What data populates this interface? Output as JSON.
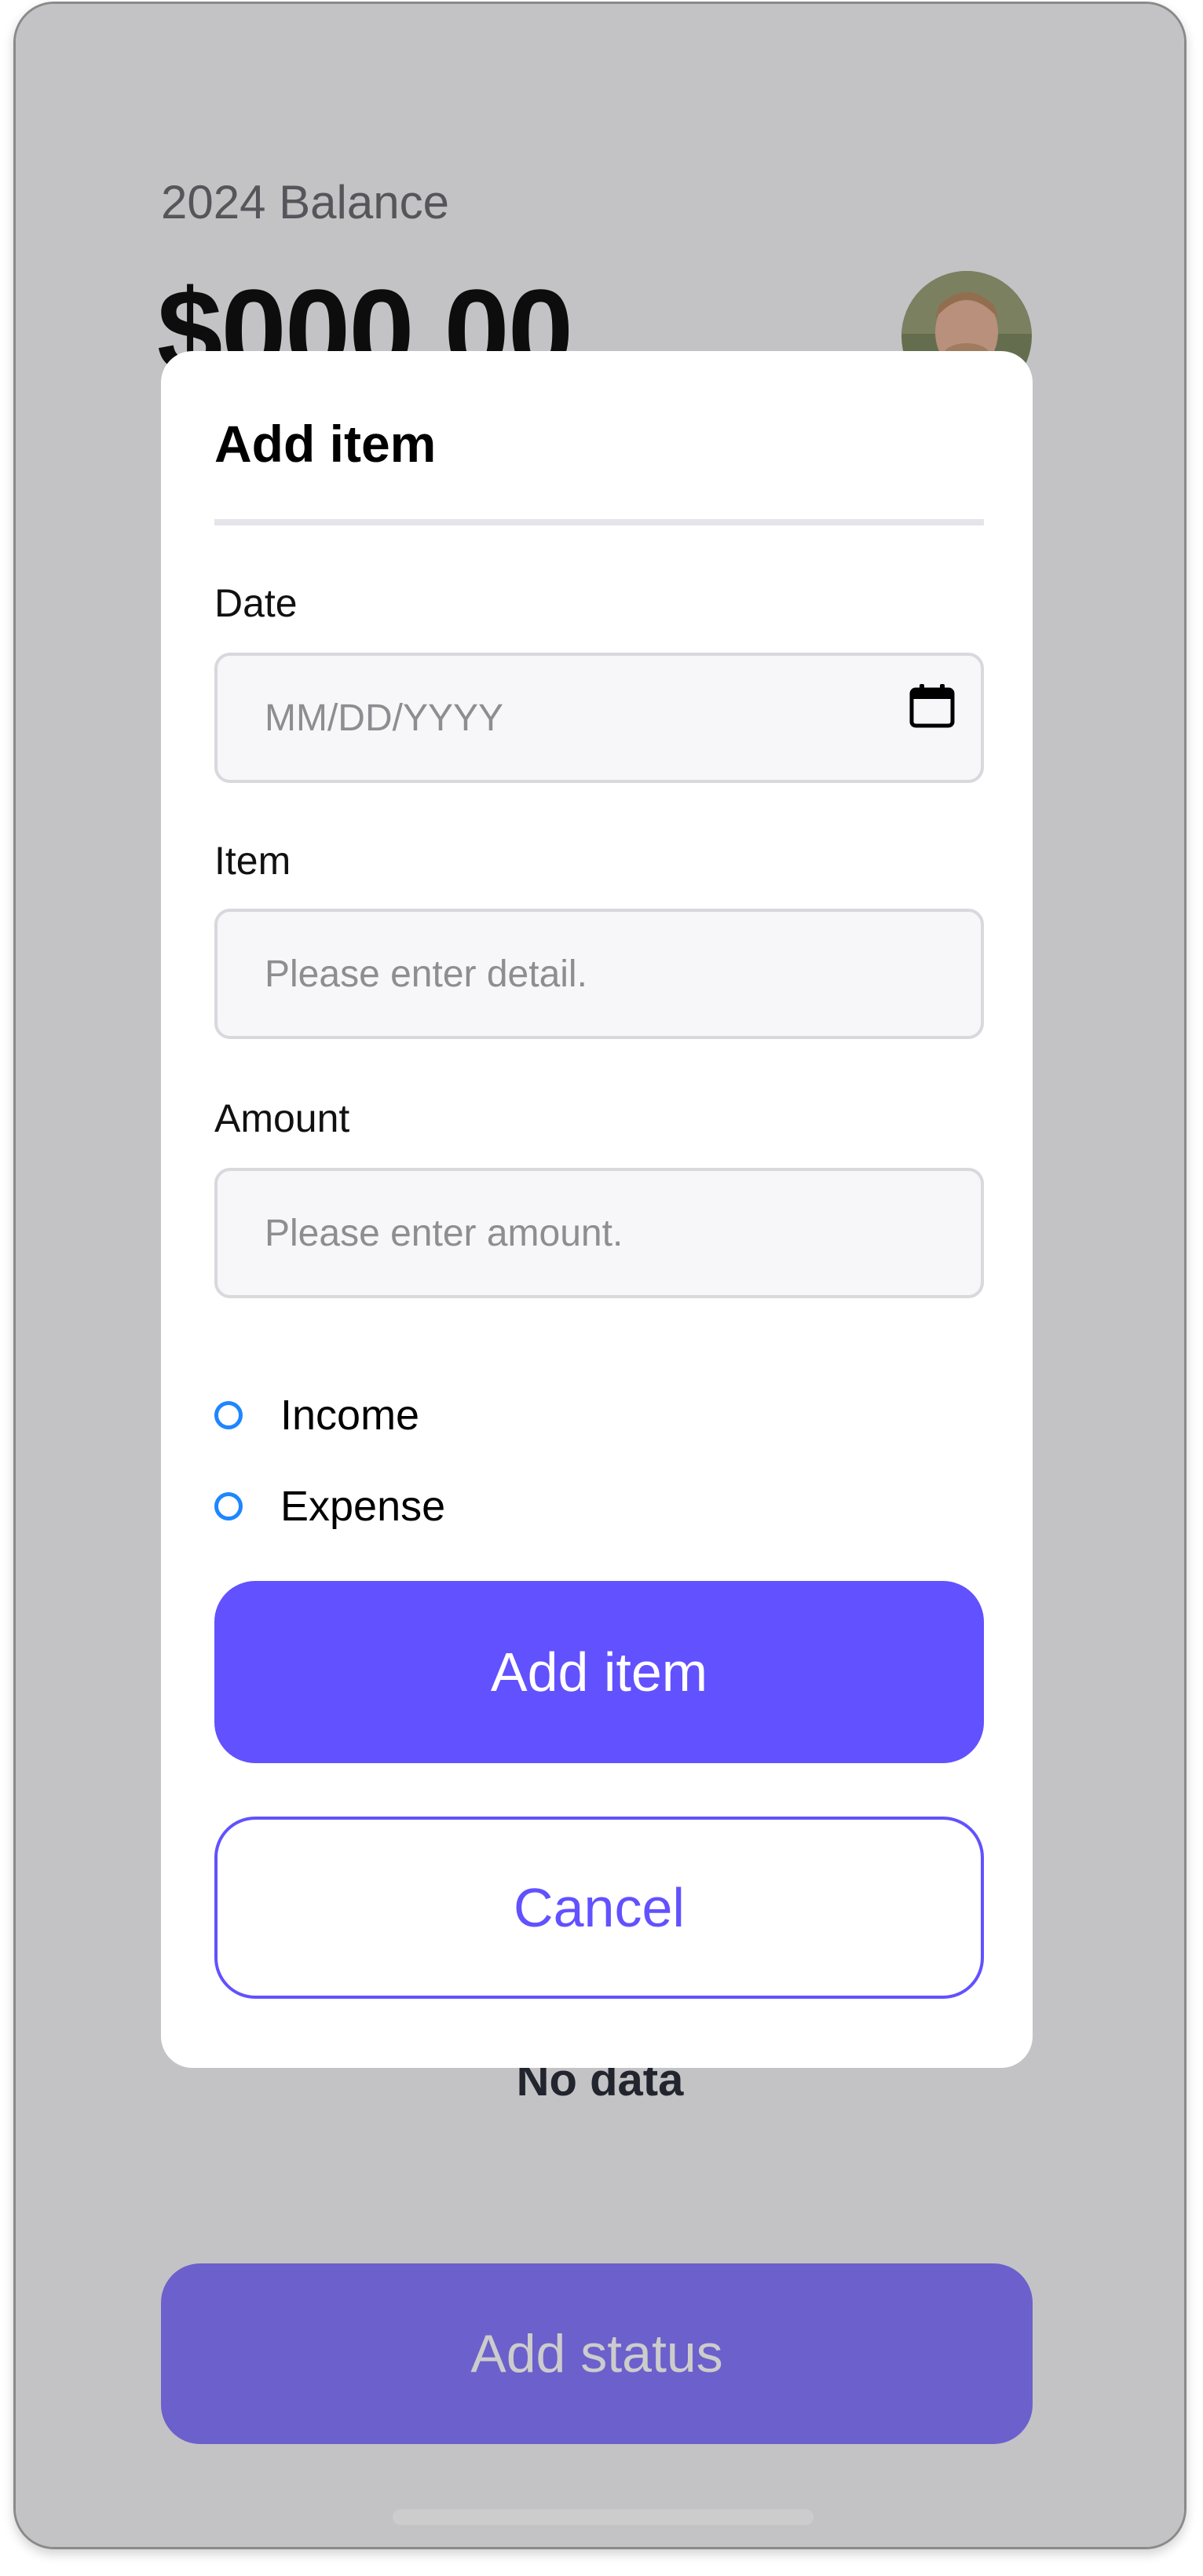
{
  "screen": {
    "balance_label": "2024 Balance",
    "balance_amount": "$000.00",
    "no_data_text": "No data",
    "add_status_label": "Add status"
  },
  "modal": {
    "title": "Add item",
    "date": {
      "label": "Date",
      "placeholder": "MM/DD/YYYY",
      "icon": "calendar-icon"
    },
    "item": {
      "label": "Item",
      "placeholder": "Please enter detail."
    },
    "amount": {
      "label": "Amount",
      "placeholder": "Please enter amount."
    },
    "options": [
      "Income",
      "Expense"
    ],
    "add_button_label": "Add item",
    "cancel_button_label": "Cancel"
  },
  "colors": {
    "primary": "#6251ff",
    "radio": "#1e86ff",
    "overlay": "rgba(0,0,0,0.20)"
  }
}
